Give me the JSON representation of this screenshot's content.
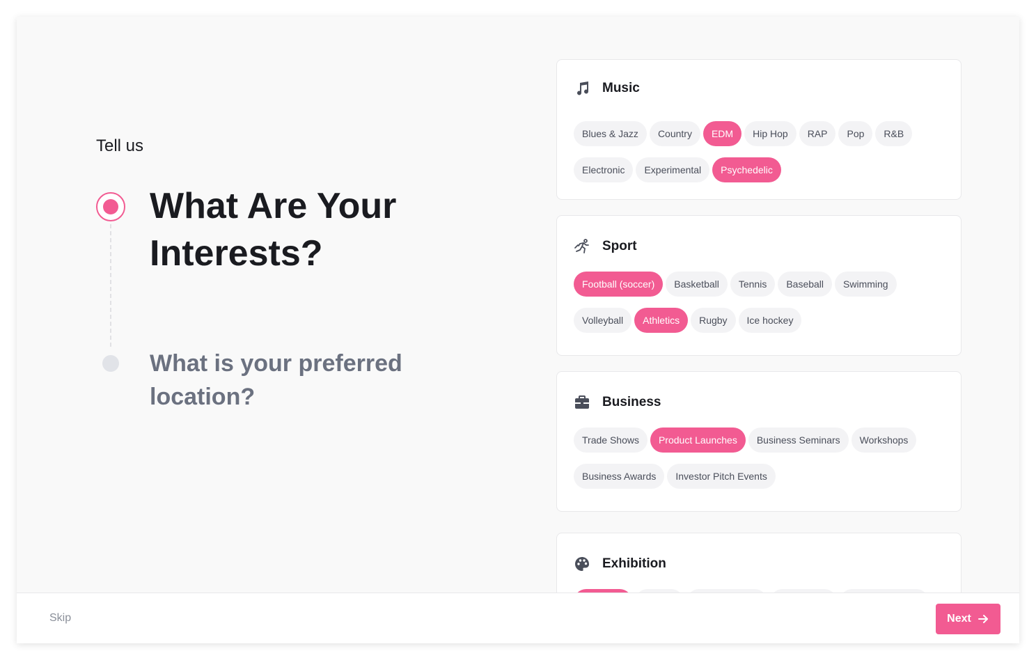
{
  "left": {
    "intro": "Tell us",
    "current_step": {
      "line1": "What Are Your",
      "line2": "Interests?"
    },
    "next_step": {
      "line1": "What is your preferred",
      "line2": "location?"
    }
  },
  "accent_color": "#f25b92",
  "categories": [
    {
      "title": "Music",
      "icon": "music-note-icon",
      "tags": [
        {
          "label": "Blues & Jazz",
          "selected": false
        },
        {
          "label": "Country",
          "selected": false
        },
        {
          "label": "EDM",
          "selected": true
        },
        {
          "label": "Hip Hop",
          "selected": false
        },
        {
          "label": "RAP",
          "selected": false
        },
        {
          "label": "Pop",
          "selected": false
        },
        {
          "label": "R&B",
          "selected": false
        },
        {
          "label": "Electronic",
          "selected": false
        },
        {
          "label": "Experimental",
          "selected": false
        },
        {
          "label": "Psychedelic",
          "selected": true
        }
      ]
    },
    {
      "title": "Sport",
      "icon": "running-person-icon",
      "tags": [
        {
          "label": "Football (soccer)",
          "selected": true
        },
        {
          "label": "Basketball",
          "selected": false
        },
        {
          "label": "Tennis",
          "selected": false
        },
        {
          "label": "Baseball",
          "selected": false
        },
        {
          "label": "Swimming",
          "selected": false
        },
        {
          "label": "Volleyball",
          "selected": false
        },
        {
          "label": "Athletics",
          "selected": true
        },
        {
          "label": "Rugby",
          "selected": false
        },
        {
          "label": "Ice hockey",
          "selected": false
        }
      ]
    },
    {
      "title": "Business",
      "icon": "briefcase-icon",
      "tags": [
        {
          "label": "Trade Shows",
          "selected": false
        },
        {
          "label": "Product Launches",
          "selected": true
        },
        {
          "label": "Business Seminars",
          "selected": false
        },
        {
          "label": "Workshops",
          "selected": false
        },
        {
          "label": "Business Awards",
          "selected": false
        },
        {
          "label": "Investor Pitch Events",
          "selected": false
        }
      ]
    },
    {
      "title": "Exhibition",
      "icon": "palette-icon",
      "tags": []
    }
  ],
  "footer": {
    "skip_label": "Skip",
    "next_label": "Next"
  }
}
